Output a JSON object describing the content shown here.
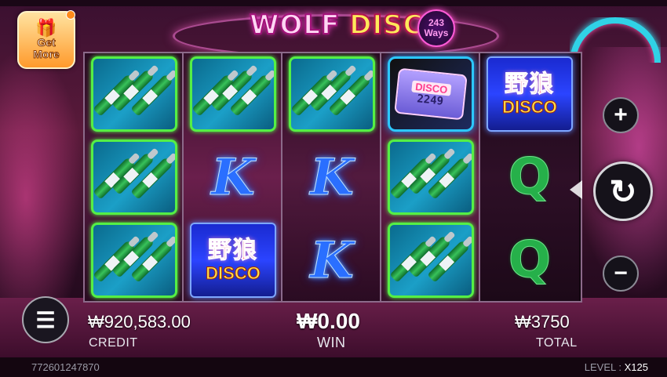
{
  "game": {
    "logo_word1": "WOLF",
    "logo_word2": "DISCO",
    "ways_number": "243",
    "ways_label": "Ways"
  },
  "get_more": {
    "label_line1": "Get",
    "label_line2": "More",
    "icon": "gift-icon"
  },
  "reels": [
    [
      "bottles",
      "bottles",
      "bottles"
    ],
    [
      "bottles",
      "K",
      "wild"
    ],
    [
      "bottles",
      "K",
      "K"
    ],
    [
      "scatter-pager",
      "bottles",
      "bottles"
    ],
    [
      "wild",
      "Q",
      "Q"
    ]
  ],
  "symbols": {
    "K": "K",
    "Q": "Q",
    "wild_cn": "野狼",
    "wild_en": "DISCO",
    "pager_top": "DISCO",
    "pager_num": "2249"
  },
  "controls": {
    "plus": "+",
    "minus": "−",
    "spin": "↻",
    "menu": "☰"
  },
  "footer": {
    "credit_value": "₩920,583.00",
    "credit_label": "CREDIT",
    "win_value": "₩0.00",
    "win_label": "WIN",
    "total_value": "₩3750",
    "total_label": "TOTAL"
  },
  "status": {
    "round_id": "772601247870",
    "level_label": "LEVEL :",
    "level_value": "X125"
  },
  "colors": {
    "accent_pink": "#ff4fd0",
    "tile_green": "#55ef45",
    "k_blue": "#2a6fff",
    "q_green": "#26b04a"
  }
}
